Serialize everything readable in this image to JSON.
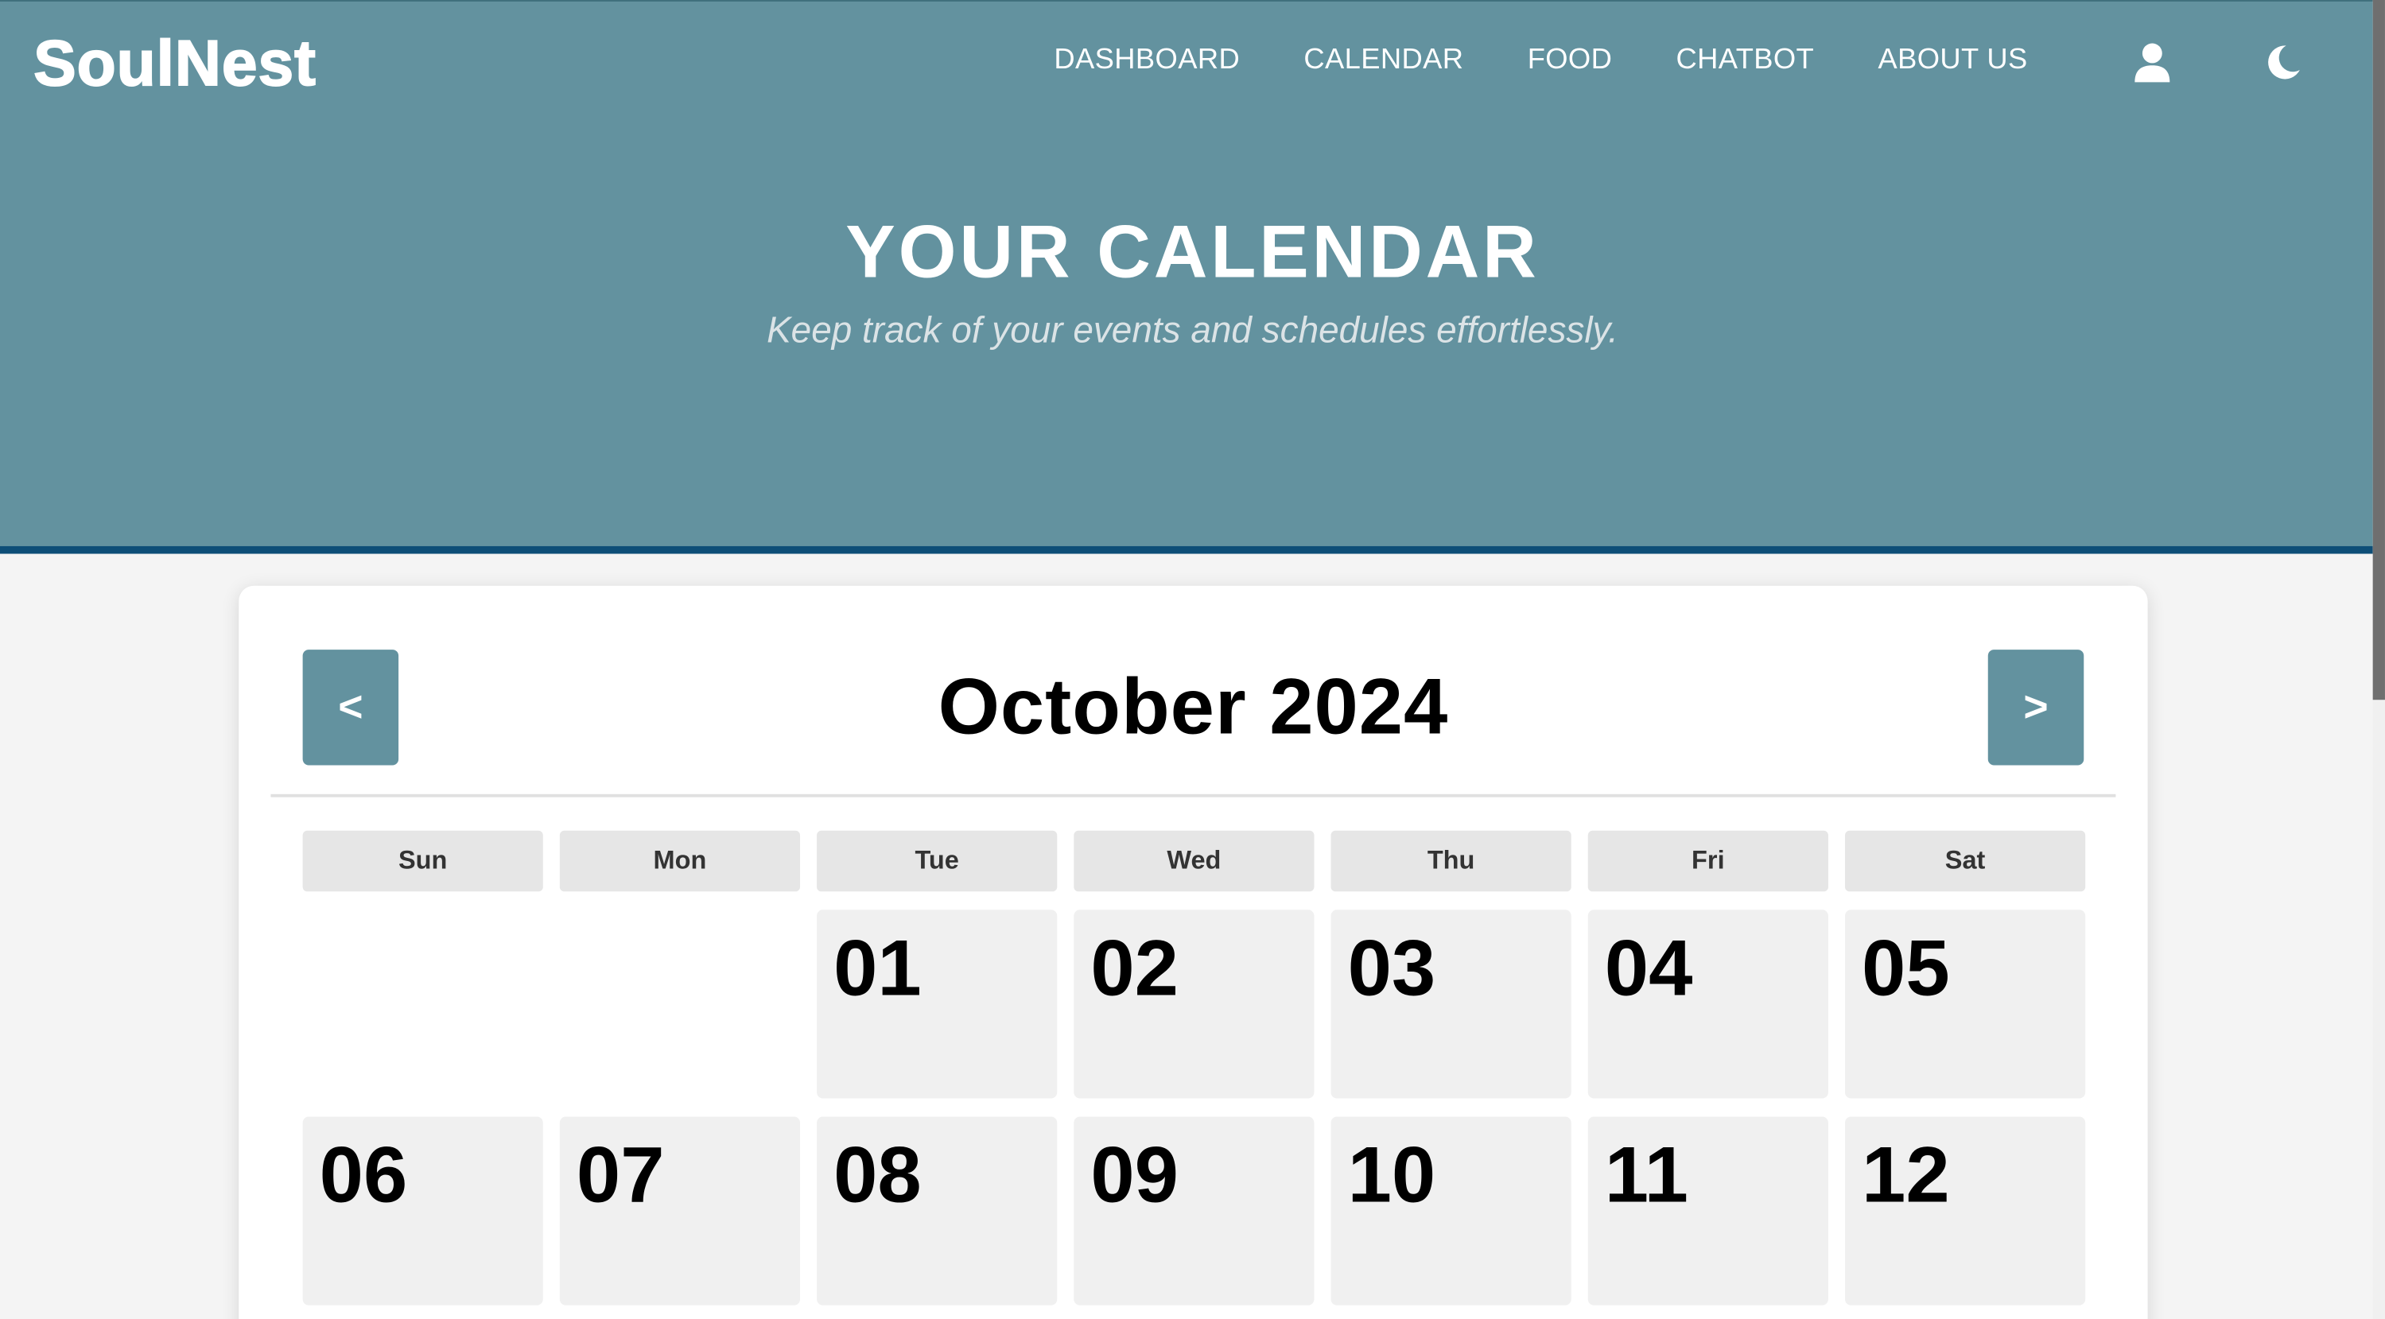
{
  "brand": "SoulNest",
  "nav": {
    "items": [
      "DASHBOARD",
      "CALENDAR",
      "FOOD",
      "CHATBOT",
      "ABOUT US"
    ],
    "profile_icon": "user-icon",
    "theme_icon": "moon-icon"
  },
  "hero": {
    "title": "YOUR CALENDAR",
    "subtitle": "Keep track of your events and schedules effortlessly."
  },
  "calendar": {
    "month_label": "October 2024",
    "prev_label": "<",
    "next_label": ">",
    "weekdays": [
      "Sun",
      "Mon",
      "Tue",
      "Wed",
      "Thu",
      "Fri",
      "Sat"
    ],
    "leading_blanks": 2,
    "days": [
      "01",
      "02",
      "03",
      "04",
      "05",
      "06",
      "07",
      "08",
      "09",
      "10",
      "11",
      "12"
    ]
  },
  "colors": {
    "hero_bg": "#63929f",
    "hero_border": "#0d4e77",
    "page_bg": "#f4f4f4",
    "cell_bg": "#f0f0f0"
  }
}
